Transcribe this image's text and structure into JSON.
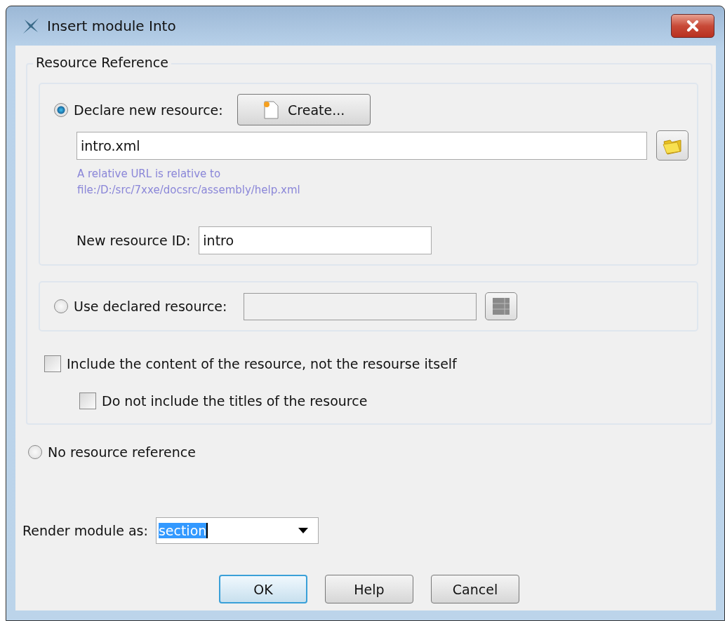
{
  "window": {
    "title": "Insert module Into"
  },
  "resource_reference": {
    "legend": "Resource Reference",
    "declare_new": {
      "label": "Declare new resource:",
      "selected": true,
      "create_button": "Create...",
      "url_value": "intro.xml",
      "hint": [
        "A relative URL is relative to",
        "file:/D:/src/7xxe/docsrc/assembly/help.xml"
      ],
      "id_label": "New resource ID:",
      "id_value": "intro"
    },
    "use_declared": {
      "label": "Use declared resource:",
      "selected": false,
      "disabled": true
    },
    "checkboxes": [
      {
        "label": "Include the content of the resource, not the resourse itself",
        "checked": false,
        "indented": false
      },
      {
        "label": "Do not include the titles of the resource",
        "checked": false,
        "indented": true
      }
    ]
  },
  "no_reference": {
    "label": "No resource reference",
    "selected": false
  },
  "render_as": {
    "label": "Render module as:",
    "value": "section"
  },
  "buttons": [
    {
      "label": "OK",
      "default": true
    },
    {
      "label": "Help",
      "default": false
    },
    {
      "label": "Cancel",
      "default": false
    }
  ]
}
